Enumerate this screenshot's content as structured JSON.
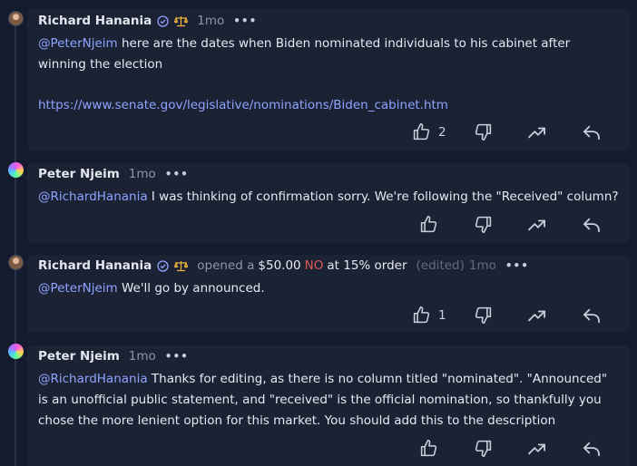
{
  "comments": [
    {
      "author": "Richard Hanania",
      "time": "1mo",
      "menu": "•••",
      "mention": "@PeterNjeim",
      "text": " here are the dates when Biden nominated individuals to his cabinet after winning the election",
      "link": "https://www.senate.gov/legislative/nominations/Biden_cabinet.htm",
      "like_count": "2"
    },
    {
      "author": "Peter Njeim",
      "time": "1mo",
      "menu": "•••",
      "mention": "@RichardHanania",
      "text": " I was thinking of confirmation sorry. We're following the \"Received\" column?"
    },
    {
      "author": "Richard Hanania",
      "action_prefix": "opened a",
      "amount": "$50.00",
      "outcome": "NO",
      "action_suffix": "at 15% order",
      "edited": "(edited)",
      "time": "1mo",
      "menu": "•••",
      "mention": "@PeterNjeim",
      "text": " We'll go by announced.",
      "like_count": "1"
    },
    {
      "author": "Peter Njeim",
      "time": "1mo",
      "menu": "•••",
      "mention": "@RichardHanania",
      "text": " Thanks for editing, as there is no column titled \"nominated\". \"Announced\" is an unofficial public statement, and \"received\" is the official nomination, so thankfully you chose the more lenient option for this market. You should add this to the description"
    }
  ],
  "icons": {
    "like": "thumbs-up-icon",
    "dislike": "thumbs-down-icon",
    "trend": "trending-up-icon",
    "reply": "reply-icon",
    "verified": "verified-check-icon",
    "badge": "scale-icon"
  },
  "colors": {
    "background": "#141b2e",
    "card": "#1b2234",
    "mention": "#8fa3ff",
    "no": "#e05a5a",
    "muted": "#8d95a8"
  }
}
